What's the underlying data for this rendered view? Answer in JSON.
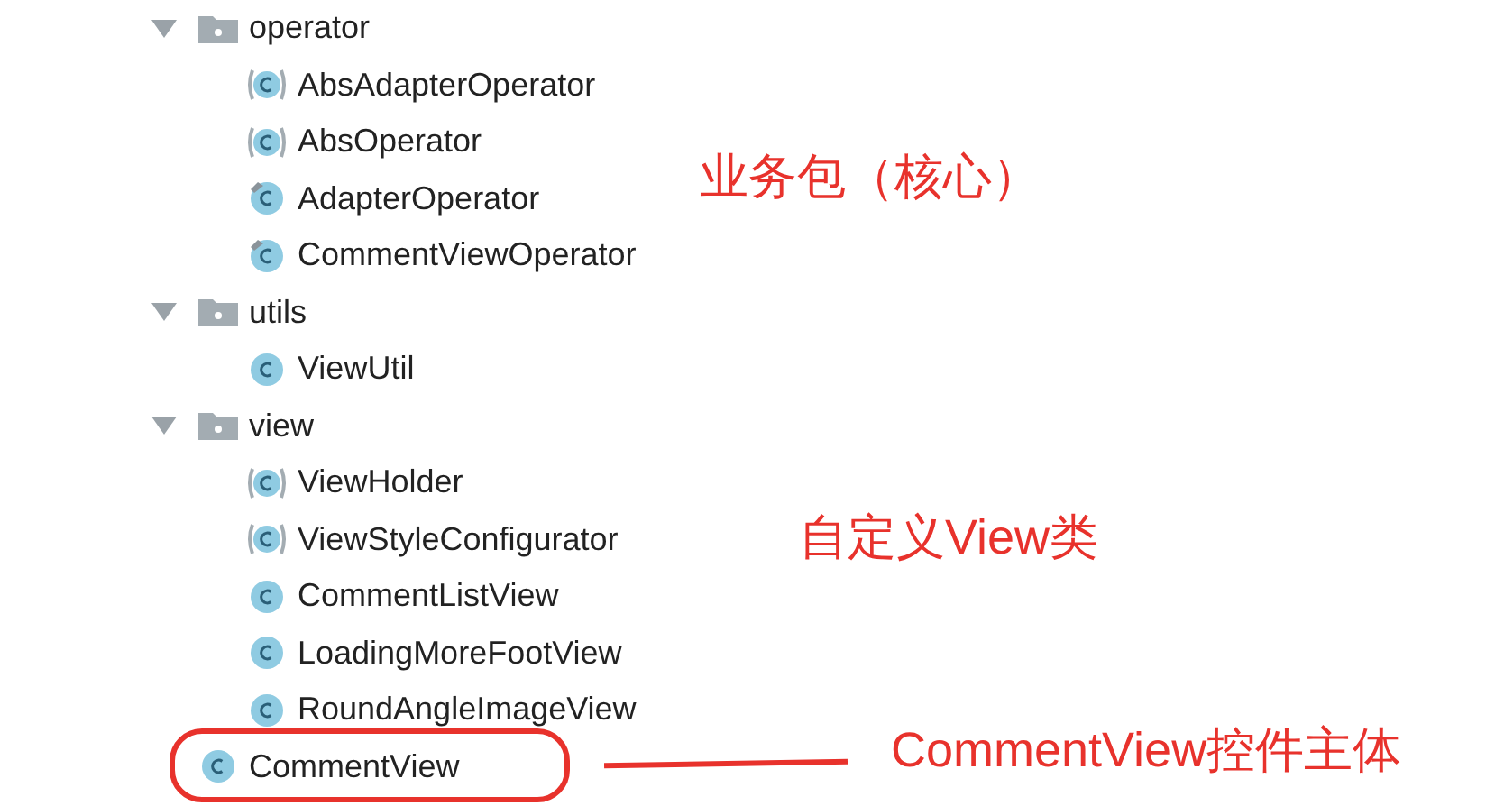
{
  "tree": [
    {
      "kind": "package",
      "label": "operator",
      "expanded": true,
      "children": [
        {
          "kind": "abstract",
          "label": "AbsAdapterOperator"
        },
        {
          "kind": "abstract",
          "label": "AbsOperator"
        },
        {
          "kind": "marked",
          "label": "AdapterOperator"
        },
        {
          "kind": "marked",
          "label": "CommentViewOperator"
        }
      ]
    },
    {
      "kind": "package",
      "label": "utils",
      "expanded": true,
      "children": [
        {
          "kind": "class",
          "label": "ViewUtil"
        }
      ]
    },
    {
      "kind": "package",
      "label": "view",
      "expanded": true,
      "children": [
        {
          "kind": "abstract",
          "label": "ViewHolder"
        },
        {
          "kind": "abstract",
          "label": "ViewStyleConfigurator"
        },
        {
          "kind": "class",
          "label": "CommentListView"
        },
        {
          "kind": "class",
          "label": "LoadingMoreFootView"
        },
        {
          "kind": "class",
          "label": "RoundAngleImageView"
        }
      ]
    },
    {
      "kind": "class",
      "label": "CommentView"
    }
  ],
  "annotations": [
    {
      "text": "业务包（核心）"
    },
    {
      "text": "自定义View类"
    },
    {
      "text": "CommentView控件主体"
    }
  ]
}
